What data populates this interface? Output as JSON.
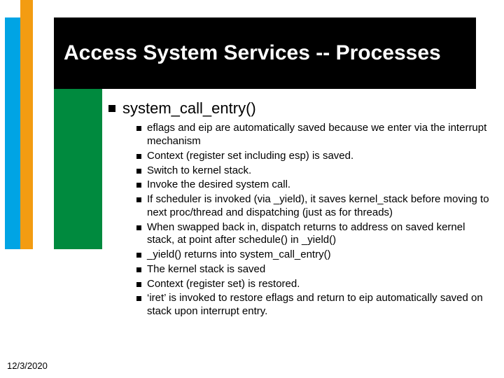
{
  "slide": {
    "title": "Access System Services -- Processes",
    "heading": "system_call_entry()",
    "bullets": [
      "eflags and eip are automatically saved because we enter via the interrupt mechanism",
      "Context (register set including esp) is saved.",
      "Switch to kernel stack.",
      "Invoke the desired system call.",
      "If scheduler is invoked (via _yield), it saves kernel_stack before moving to next proc/thread and dispatching (just as for threads)",
      "When swapped back in, dispatch returns to address on saved kernel stack, at point after schedule() in _yield()",
      "_yield() returns into system_call_entry()",
      "The kernel stack is saved",
      "Context (register set) is restored.",
      "‘iret’ is invoked to restore eflags and return to eip automatically saved on stack upon interrupt entry."
    ],
    "date": "12/3/2020"
  }
}
